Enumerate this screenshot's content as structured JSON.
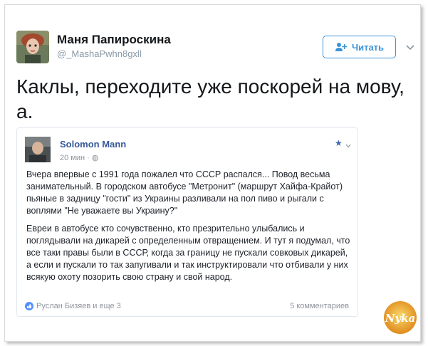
{
  "tweet": {
    "author_name": "Маня Папироскина",
    "author_handle": "@_MashaPwhn8gxll",
    "follow_label": "Читать",
    "text": "Каклы, переходите уже поскорей на мову, а."
  },
  "quoted_post": {
    "author_name": "Solomon Mann",
    "meta": "20 мин · ",
    "paragraph1": "Вчера впервые с 1991 года пожалел что СССР распался... Повод весьма занимательный. В городском автобусе \"Метронит\" (маршрут Хайфа-Крайот) пьяные в задницу \"гости\" из Украины разливали на пол пиво и рыгали с воплями \"Не уважаете вы Украину?\"",
    "paragraph2": "Евреи в автобусе кто сочувственно, кто презрительно улыбались и поглядывали на дикарей с определенным отвращением. И тут я подумал, что все таки правы были в СССР, когда за границу не пускали совковых дикарей, а если и пускали то так запугивали и так инструктировали что отбивали у них всякую охоту позорить свою страну и свой народ.",
    "likes_text": "Руслан Бизяев и еще 3",
    "comments_text": "5 комментариев"
  },
  "watermark": {
    "text": "Nyka"
  },
  "colors": {
    "accent": "#3b94d9",
    "fb_blue": "#365899"
  }
}
